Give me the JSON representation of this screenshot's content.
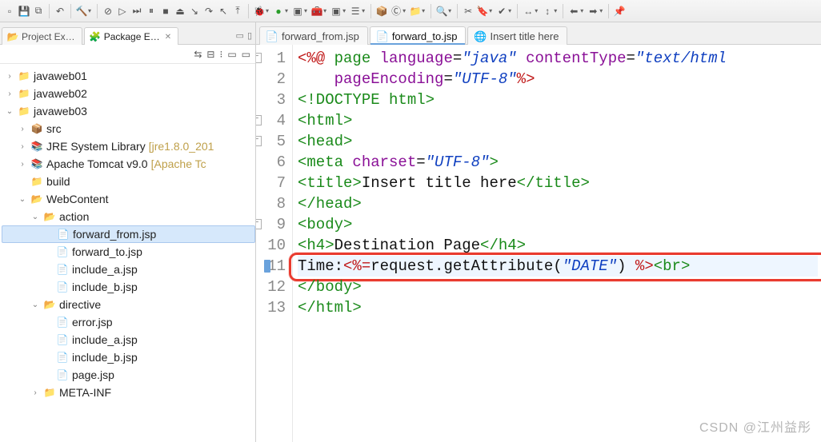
{
  "toolbar": {
    "buttons": [
      {
        "name": "new-icon",
        "glyph": "▫"
      },
      {
        "name": "save-icon",
        "glyph": "💾"
      },
      {
        "name": "save-all-icon",
        "glyph": "⧉"
      },
      {
        "sep": true
      },
      {
        "name": "undo-icon",
        "glyph": "↶"
      },
      {
        "sep": true
      },
      {
        "name": "hammer-icon",
        "glyph": "🔨",
        "dd": true
      },
      {
        "sep": true
      },
      {
        "name": "debug-no-icon",
        "glyph": "⊘"
      },
      {
        "name": "play-icon",
        "glyph": "▷"
      },
      {
        "name": "skip-icon",
        "glyph": "⏭"
      },
      {
        "name": "pause-icon",
        "glyph": "⏸"
      },
      {
        "name": "stop-icon",
        "glyph": "■"
      },
      {
        "name": "disconnect-icon",
        "glyph": "⏏"
      },
      {
        "name": "step-into-icon",
        "glyph": "↘"
      },
      {
        "name": "step-over-icon",
        "glyph": "↷"
      },
      {
        "name": "step-return-icon",
        "glyph": "↖"
      },
      {
        "name": "drop-frame-icon",
        "glyph": "⤒"
      },
      {
        "sep": true
      },
      {
        "name": "bug-icon",
        "glyph": "🐞",
        "dd": true
      },
      {
        "name": "run-icon",
        "glyph": "●",
        "color": "#2a9d2a",
        "dd": true
      },
      {
        "name": "coverage-icon",
        "glyph": "▣",
        "dd": true
      },
      {
        "name": "ext-tools-icon",
        "glyph": "🧰",
        "dd": true
      },
      {
        "name": "profile-icon",
        "glyph": "▣",
        "dd": true
      },
      {
        "name": "server-icon",
        "glyph": "☰",
        "dd": true
      },
      {
        "sep": true
      },
      {
        "name": "new-pkg-icon",
        "glyph": "📦"
      },
      {
        "name": "new-class-icon",
        "glyph": "Ⓒ",
        "dd": true
      },
      {
        "name": "new-folder-icon",
        "glyph": "📁",
        "dd": true
      },
      {
        "sep": true
      },
      {
        "name": "search-icon",
        "glyph": "🔍",
        "dd": true
      },
      {
        "sep": true
      },
      {
        "name": "cut-icon",
        "glyph": "✂"
      },
      {
        "name": "tag-icon",
        "glyph": "🔖",
        "dd": true
      },
      {
        "name": "task-icon",
        "glyph": "✔",
        "dd": true
      },
      {
        "sep": true
      },
      {
        "name": "toggle-icon",
        "glyph": "↔",
        "dd": true
      },
      {
        "name": "toggle2-icon",
        "glyph": "↕",
        "dd": true
      },
      {
        "sep": true
      },
      {
        "name": "back-icon",
        "glyph": "⬅",
        "dd": true
      },
      {
        "name": "fwd-icon",
        "glyph": "➡",
        "dd": true
      },
      {
        "sep": true
      },
      {
        "name": "pin-icon",
        "glyph": "📌"
      }
    ]
  },
  "leftViews": {
    "tabs": [
      {
        "name": "project-explorer",
        "label": "Project Ex…",
        "icon": "📂",
        "active": false
      },
      {
        "name": "package-explorer",
        "label": "Package E…",
        "icon": "🧩",
        "active": true
      }
    ],
    "miniToolbar": [
      "⇆",
      "⊟",
      "⁝",
      "▭",
      "▭"
    ]
  },
  "tree": [
    {
      "d": 0,
      "tw": ">",
      "ic": "📁",
      "label": "javaweb01",
      "name": "project-javaweb01",
      "cls": ""
    },
    {
      "d": 0,
      "tw": ">",
      "ic": "📁",
      "label": "javaweb02",
      "name": "project-javaweb02",
      "cls": ""
    },
    {
      "d": 0,
      "tw": "v",
      "ic": "📁",
      "label": "javaweb03",
      "name": "project-javaweb03",
      "cls": ""
    },
    {
      "d": 1,
      "tw": ">",
      "ic": "📦",
      "label": "src",
      "name": "folder-src"
    },
    {
      "d": 1,
      "tw": ">",
      "ic": "📚",
      "label": "JRE System Library ",
      "qual": "[jre1.8.0_201",
      "name": "jre-library"
    },
    {
      "d": 1,
      "tw": ">",
      "ic": "📚",
      "label": "Apache Tomcat v9.0 ",
      "qual": "[Apache Tc",
      "name": "tomcat-library"
    },
    {
      "d": 1,
      "tw": "",
      "ic": "📁",
      "label": "build",
      "name": "folder-build"
    },
    {
      "d": 1,
      "tw": "v",
      "ic": "📂",
      "label": "WebContent",
      "name": "folder-webcontent"
    },
    {
      "d": 2,
      "tw": "v",
      "ic": "📂",
      "label": "action",
      "name": "folder-action"
    },
    {
      "d": 3,
      "tw": "",
      "ic": "📄",
      "label": "forward_from.jsp",
      "name": "file-forward-from",
      "selected": true
    },
    {
      "d": 3,
      "tw": "",
      "ic": "📄",
      "label": "forward_to.jsp",
      "name": "file-forward-to"
    },
    {
      "d": 3,
      "tw": "",
      "ic": "📄",
      "label": "include_a.jsp",
      "name": "file-include-a"
    },
    {
      "d": 3,
      "tw": "",
      "ic": "📄",
      "label": "include_b.jsp",
      "name": "file-include-b"
    },
    {
      "d": 2,
      "tw": "v",
      "ic": "📂",
      "label": "directive",
      "name": "folder-directive"
    },
    {
      "d": 3,
      "tw": "",
      "ic": "📄",
      "label": "error.jsp",
      "name": "file-error"
    },
    {
      "d": 3,
      "tw": "",
      "ic": "📄",
      "label": "include_a.jsp",
      "name": "file-dir-include-a"
    },
    {
      "d": 3,
      "tw": "",
      "ic": "📄",
      "label": "include_b.jsp",
      "name": "file-dir-include-b"
    },
    {
      "d": 3,
      "tw": "",
      "ic": "📄",
      "label": "page.jsp",
      "name": "file-page"
    },
    {
      "d": 2,
      "tw": ">",
      "ic": "📁",
      "label": "META-INF",
      "name": "folder-meta-inf"
    }
  ],
  "editorTabs": [
    {
      "name": "tab-forward-from",
      "label": "forward_from.jsp",
      "icon": "📄",
      "active": false
    },
    {
      "name": "tab-forward-to",
      "label": "forward_to.jsp",
      "icon": "📄",
      "active": true
    },
    {
      "name": "tab-browser",
      "label": "Insert title here",
      "icon": "🌐",
      "active": false
    }
  ],
  "code": {
    "lines": [
      {
        "n": 1,
        "fold": true,
        "seg": [
          {
            "t": "<%@ ",
            "c": "c-jsp"
          },
          {
            "t": "page ",
            "c": "c-tag"
          },
          {
            "t": "language",
            "c": "c-attr"
          },
          {
            "t": "=",
            "c": "c-txt"
          },
          {
            "t": "\"java\"",
            "c": "c-str"
          },
          {
            "t": " ",
            "c": ""
          },
          {
            "t": "contentType",
            "c": "c-attr"
          },
          {
            "t": "=",
            "c": "c-txt"
          },
          {
            "t": "\"text/html",
            "c": "c-str"
          }
        ]
      },
      {
        "n": 2,
        "seg": [
          {
            "t": "    ",
            "c": ""
          },
          {
            "t": "pageEncoding",
            "c": "c-attr"
          },
          {
            "t": "=",
            "c": "c-txt"
          },
          {
            "t": "\"UTF-8\"",
            "c": "c-str"
          },
          {
            "t": "%>",
            "c": "c-jsp"
          }
        ]
      },
      {
        "n": 3,
        "seg": [
          {
            "t": "<!DOCTYPE html>",
            "c": "c-doc"
          }
        ]
      },
      {
        "n": 4,
        "fold": true,
        "seg": [
          {
            "t": "<html>",
            "c": "c-tag"
          }
        ]
      },
      {
        "n": 5,
        "fold": true,
        "seg": [
          {
            "t": "<head>",
            "c": "c-tag"
          }
        ]
      },
      {
        "n": 6,
        "seg": [
          {
            "t": "<meta ",
            "c": "c-tag"
          },
          {
            "t": "charset",
            "c": "c-attr"
          },
          {
            "t": "=",
            "c": "c-txt"
          },
          {
            "t": "\"UTF-8\"",
            "c": "c-str"
          },
          {
            "t": ">",
            "c": "c-tag"
          }
        ]
      },
      {
        "n": 7,
        "seg": [
          {
            "t": "<title>",
            "c": "c-tag"
          },
          {
            "t": "Insert title here",
            "c": "c-txt"
          },
          {
            "t": "</title>",
            "c": "c-tag"
          }
        ]
      },
      {
        "n": 8,
        "seg": [
          {
            "t": "</head>",
            "c": "c-tag"
          }
        ]
      },
      {
        "n": 9,
        "fold": true,
        "seg": [
          {
            "t": "<body>",
            "c": "c-tag"
          }
        ]
      },
      {
        "n": 10,
        "seg": [
          {
            "t": "<h4>",
            "c": "c-tag"
          },
          {
            "t": "Destination Page",
            "c": "c-txt"
          },
          {
            "t": "</h4>",
            "c": "c-tag"
          }
        ]
      },
      {
        "n": 11,
        "hl": true,
        "bp": true,
        "seg": [
          {
            "t": "Time:",
            "c": "c-txt"
          },
          {
            "t": "<%=",
            "c": "c-jsp"
          },
          {
            "t": "request.getAttribute(",
            "c": "c-txt"
          },
          {
            "t": "\"DATE\"",
            "c": "c-str"
          },
          {
            "t": ") ",
            "c": "c-txt"
          },
          {
            "t": "%>",
            "c": "c-jsp"
          },
          {
            "t": "<br>",
            "c": "c-tag"
          }
        ]
      },
      {
        "n": 12,
        "seg": [
          {
            "t": "</body>",
            "c": "c-tag"
          }
        ]
      },
      {
        "n": 13,
        "seg": [
          {
            "t": "</html>",
            "c": "c-tag"
          }
        ]
      }
    ]
  },
  "watermark": "CSDN @江州益彤"
}
